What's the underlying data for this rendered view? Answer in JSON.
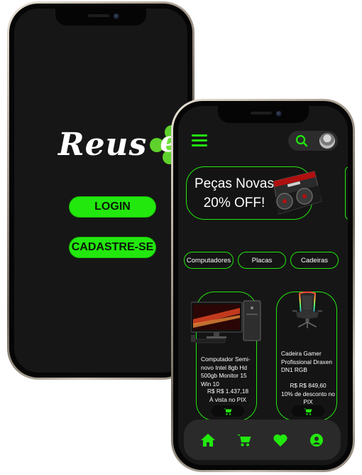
{
  "login_screen": {
    "brand": {
      "text": "Reus",
      "suffix": "e"
    },
    "buttons": {
      "login_label": "LOGIN",
      "signup_label": "CADASTRE-SE"
    }
  },
  "shop_screen": {
    "header": {
      "menu_icon": "hamburger-menu-icon",
      "search_icon": "search-icon",
      "avatar_icon": "user-avatar"
    },
    "banner": {
      "line1": "Peças Novas",
      "line2": "20% OFF!"
    },
    "categories": [
      "Computadores",
      "Placas",
      "Cadeiras"
    ],
    "products": [
      {
        "name": "Computador Semi-novo Intel 8gb Hd 500gb Monitor 15 Win 10",
        "price_line1": "R$ R$ 1.437,18",
        "price_line2": "À vista no PIX"
      },
      {
        "name": "Cadeira Gamer Profissional Draxen DN1 RGB",
        "price_line1": "R$ R$ 849,60",
        "price_line2": "10% de desconto no PIX"
      }
    ],
    "bottom_nav": [
      "home-icon",
      "cart-icon",
      "heart-icon",
      "profile-icon"
    ]
  },
  "colors": {
    "accent": "#22e80e",
    "screen_bg": "#161616",
    "nav_bg": "#2a2a2a"
  }
}
